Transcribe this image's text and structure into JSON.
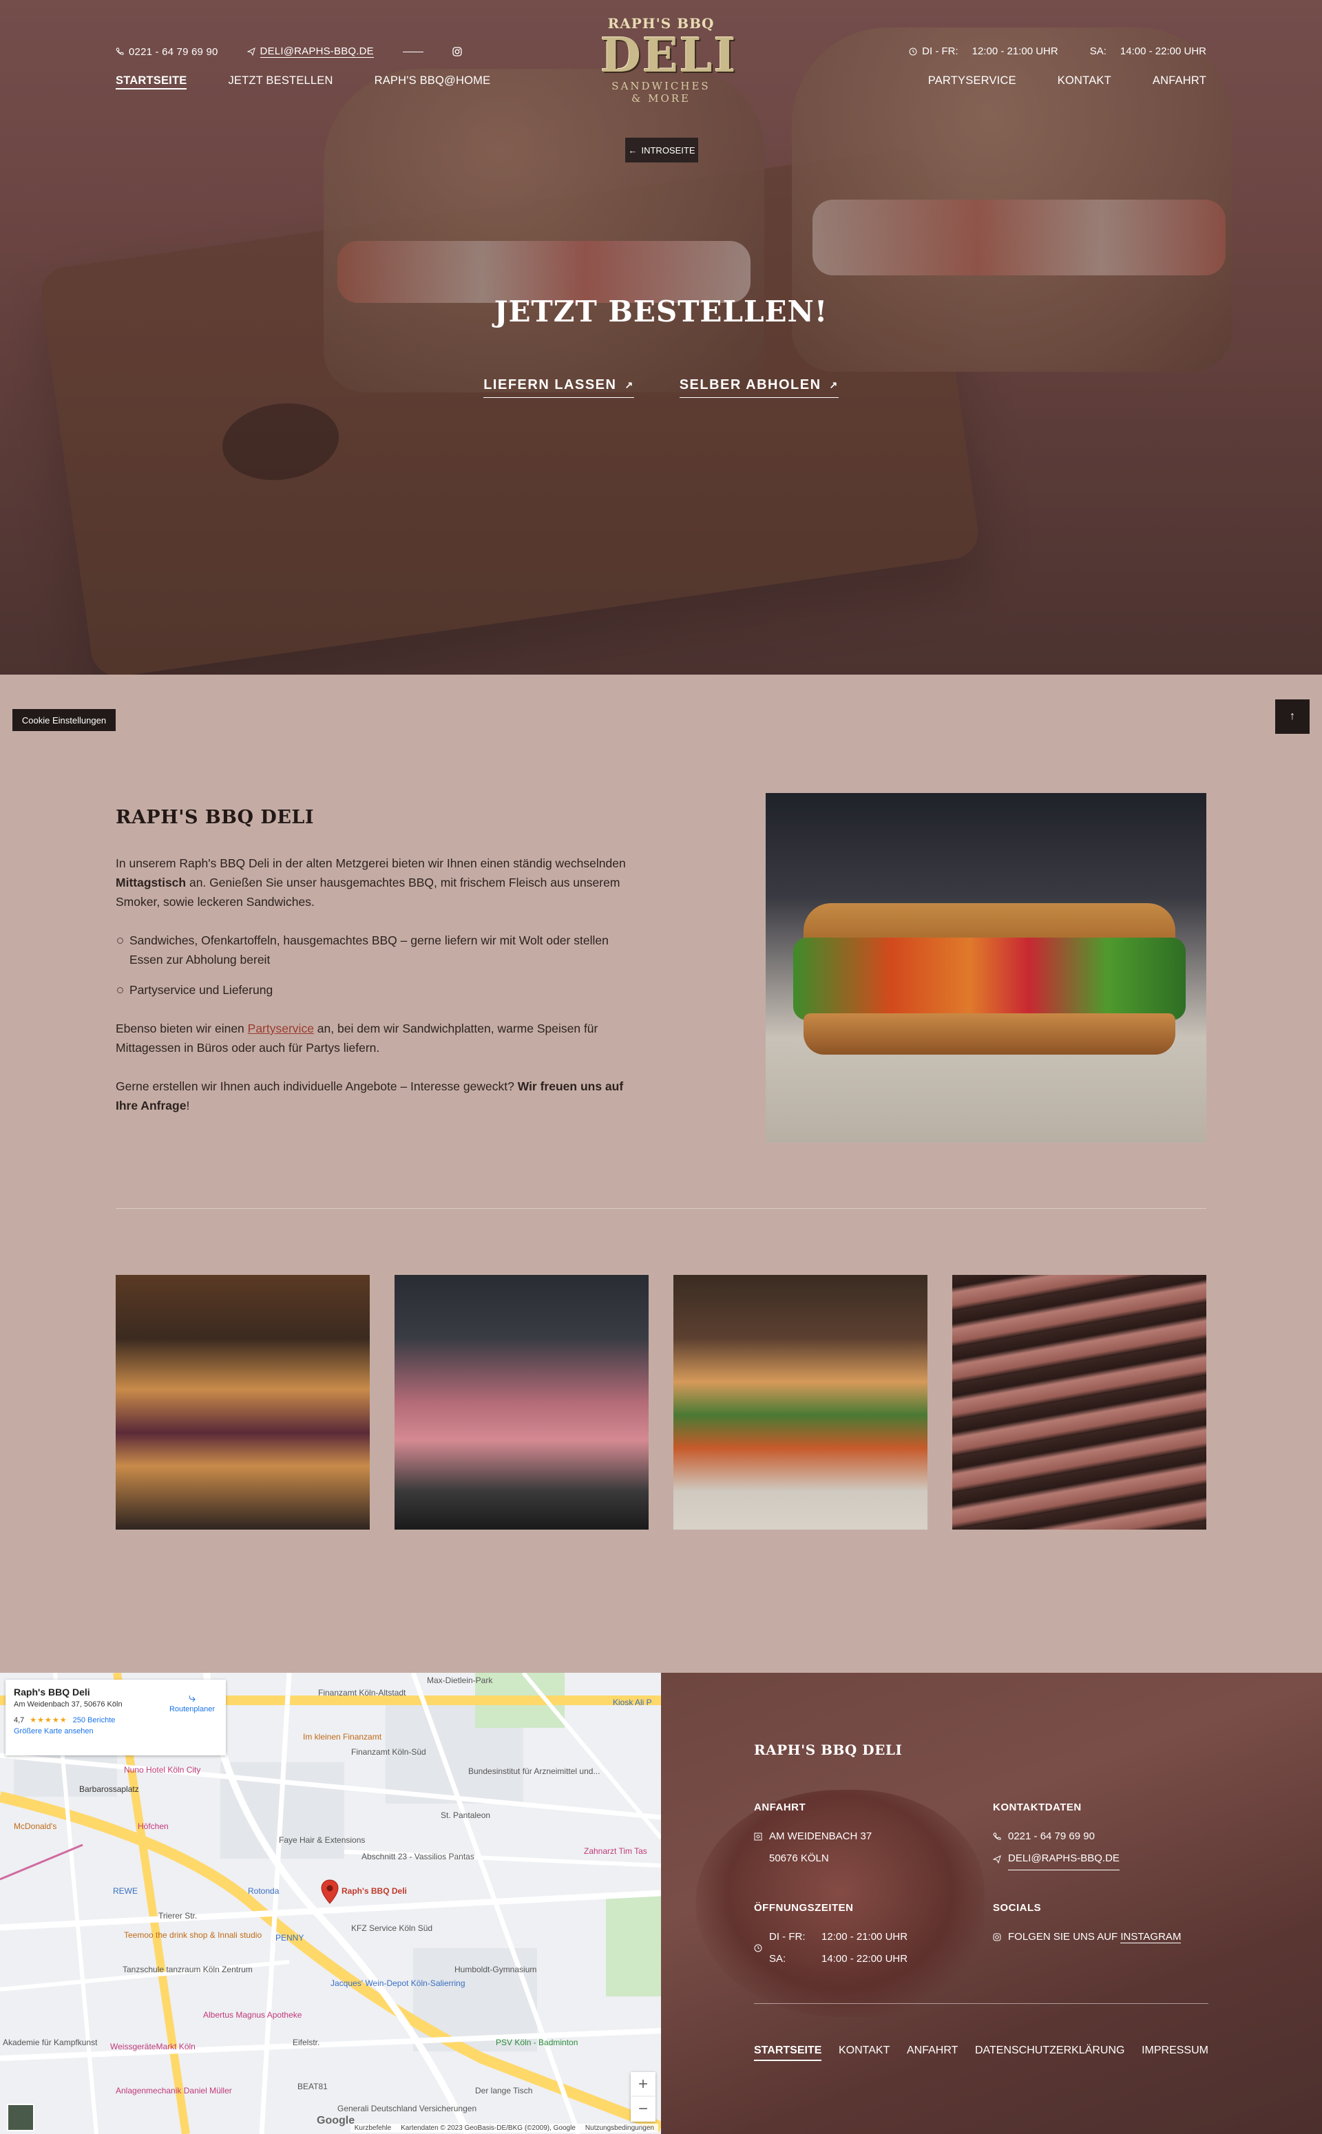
{
  "header": {
    "phone": "0221 - 64 79 69 90",
    "email": "DELI@RAPHS-BBQ.DE",
    "hours_label_1": "DI - FR:",
    "hours_value_1": "12:00 - 21:00 UHR",
    "hours_label_2": "SA:",
    "hours_value_2": "14:00 - 22:00 UHR",
    "nav_left": [
      "STARTSEITE",
      "JETZT BESTELLEN",
      "RAPH'S BBQ@HOME"
    ],
    "nav_right": [
      "PARTYSERVICE",
      "KONTAKT",
      "ANFAHRT"
    ],
    "logo": {
      "top": "RAPH'S BBQ",
      "main": "DELI",
      "sub1": "SANDWICHES",
      "sub2": "& MORE"
    },
    "intro_button": "INTROSEITE"
  },
  "hero": {
    "title": "JETZT BESTELLEN!",
    "link_delivery": "LIEFERN LASSEN",
    "link_pickup": "SELBER ABHOLEN"
  },
  "floating": {
    "cookie": "Cookie Einstellungen"
  },
  "about": {
    "title": "RAPH'S BBQ DELI",
    "p1_a": "In unserem Raph's BBQ Deli in der alten Metzgerei bieten wir Ihnen einen ständig wechselnden ",
    "p1_bold": "Mittagstisch",
    "p1_b": " an. Genießen Sie unser hausgemachtes BBQ, mit frischem Fleisch aus unserem Smoker, sowie leckeren Sandwiches.",
    "list": [
      "Sandwiches, Ofenkartoffeln, hausgemachtes BBQ – gerne liefern wir mit Wolt oder stellen Essen zur Abholung bereit",
      "Partyservice und Lieferung"
    ],
    "p2_a": "Ebenso bieten wir einen ",
    "p2_link": "Partyservice",
    "p2_b": " an, bei dem wir Sandwichplatten, warme Speisen für Mittagessen in Büros oder auch für Partys liefern.",
    "p3_a": "Gerne erstellen wir Ihnen auch individuelle Angebote – Interesse geweckt? ",
    "p3_bold": "Wir freuen uns auf Ihre Anfrage",
    "p3_b": "!"
  },
  "map": {
    "place_name": "Raph's BBQ Deli",
    "address": "Am Weidenbach 37, 50676 Köln",
    "rating": "4,7",
    "reviews": "250 Berichte",
    "bigger_map": "Größere Karte ansehen",
    "route": "Routenplaner",
    "pin_label": "Raph's BBQ Deli",
    "labels": [
      "Finanzamt Köln-Altstadt",
      "Max-Dietlein-Park",
      "Im kleinen Finanzamt",
      "Finanzamt Köln-Süd",
      "Nuno Hotel Köln City",
      "Barbarossaplatz",
      "McDonald's",
      "Höfchen",
      "St. Pantaleon",
      "Faye Hair & Extensions",
      "Abschnitt 23 - Vassilios Pantas",
      "Rotonda",
      "REWE",
      "Trierer Str.",
      "PENNY",
      "KFZ Service Köln Süd",
      "Teemoo the drink shop & Innali studio",
      "Tanzschule tanzraum Köln Zentrum",
      "Humboldt-Gymnasium",
      "Jacques' Wein-Depot Köln-Salierring",
      "Albertus Magnus Apotheke",
      "WeissgeräteMarkt Köln",
      "Eifelstr.",
      "PSV Köln - Badminton",
      "Anlagenmechanik Daniel Müller",
      "BEAT81",
      "Der lange Tisch",
      "Generali Deutschland Versicherungen",
      "Zahnarzt Tim Tas",
      "Bundesinstitut für Arzneimittel und...",
      "Akademie für Kampfkunst",
      "Kiosk Ali P"
    ],
    "attrib_shortcuts": "Kurzbefehle",
    "attrib_data": "Kartendaten © 2023 GeoBasis-DE/BKG (©2009), Google",
    "attrib_terms": "Nutzungsbedingungen",
    "google": "Google",
    "zoom_in": "+",
    "zoom_out": "−"
  },
  "footer": {
    "title": "RAPH'S BBQ DELI",
    "anfahrt_title": "ANFAHRT",
    "street": "AM WEIDENBACH 37",
    "city": "50676 KÖLN",
    "kontakt_title": "KONTAKTDATEN",
    "phone": "0221 - 64 79 69 90",
    "email": "DELI@RAPHS-BBQ.DE",
    "hours_title": "ÖFFNUNGSZEITEN",
    "hours_label_1": "DI - FR:",
    "hours_value_1": "12:00 - 21:00 UHR",
    "hours_label_2": "SA:",
    "hours_value_2": "14:00 - 22:00 UHR",
    "socials_title": "SOCIALS",
    "instagram_prefix": "FOLGEN SIE UNS AUF ",
    "instagram_link": "INSTAGRAM",
    "nav": [
      "STARTSEITE",
      "KONTAKT",
      "ANFAHRT",
      "DATENSCHUTZERKLÄRUNG",
      "IMPRESSUM"
    ]
  }
}
